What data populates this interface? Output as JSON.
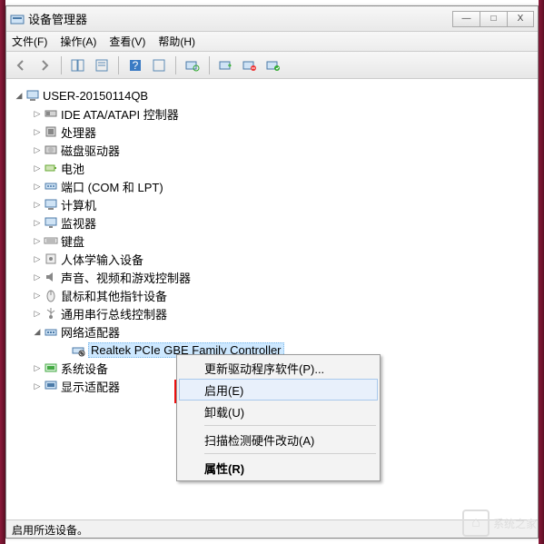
{
  "window": {
    "title": "设备管理器",
    "min": "—",
    "max": "□",
    "close": "X"
  },
  "menu": {
    "file": "文件(F)",
    "action": "操作(A)",
    "view": "查看(V)",
    "help": "帮助(H)"
  },
  "tree": {
    "root": "USER-20150114QB",
    "items": [
      {
        "label": "IDE ATA/ATAPI 控制器",
        "icon": "ide"
      },
      {
        "label": "处理器",
        "icon": "cpu"
      },
      {
        "label": "磁盘驱动器",
        "icon": "disk"
      },
      {
        "label": "电池",
        "icon": "battery"
      },
      {
        "label": "端口 (COM 和 LPT)",
        "icon": "port"
      },
      {
        "label": "计算机",
        "icon": "computer"
      },
      {
        "label": "监视器",
        "icon": "monitor"
      },
      {
        "label": "键盘",
        "icon": "keyboard"
      },
      {
        "label": "人体学输入设备",
        "icon": "hid"
      },
      {
        "label": "声音、视频和游戏控制器",
        "icon": "sound"
      },
      {
        "label": "鼠标和其他指针设备",
        "icon": "mouse"
      },
      {
        "label": "通用串行总线控制器",
        "icon": "usb"
      },
      {
        "label": "网络适配器",
        "icon": "network",
        "expanded": true,
        "children": [
          {
            "label": "Realtek PCIe GBE Family Controller",
            "icon": "nic-disabled",
            "selected": true
          }
        ]
      },
      {
        "label": "系统设备",
        "icon": "system"
      },
      {
        "label": "显示适配器",
        "icon": "display"
      }
    ]
  },
  "context_menu": {
    "update_driver": "更新驱动程序软件(P)...",
    "enable": "启用(E)",
    "uninstall": "卸载(U)",
    "scan": "扫描检测硬件改动(A)",
    "properties": "属性(R)"
  },
  "status": "启用所选设备。",
  "watermark": "系统之家"
}
